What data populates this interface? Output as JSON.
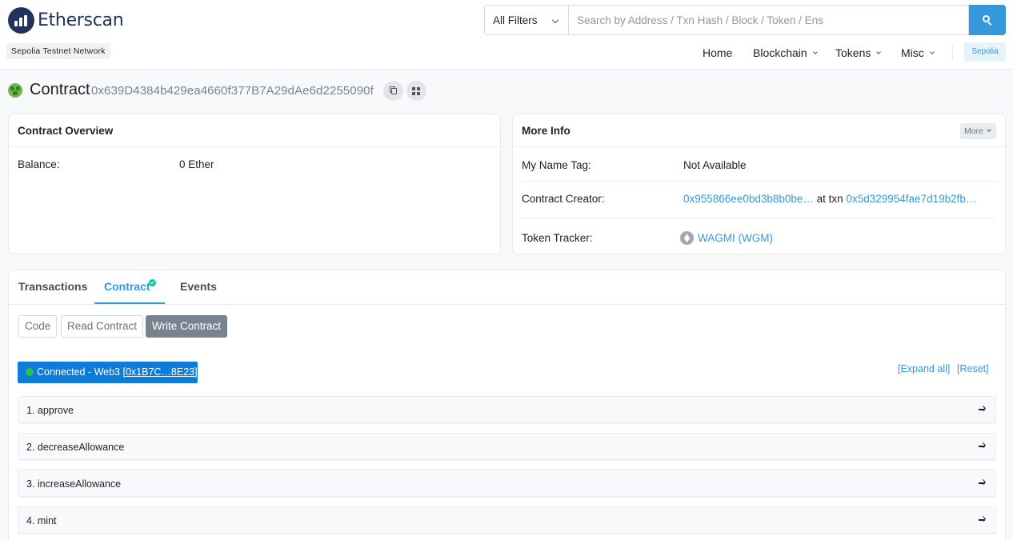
{
  "brand": {
    "name": "Etherscan",
    "network": "Sepolia Testnet Network"
  },
  "search": {
    "filter_label": "All Filters",
    "placeholder": "Search by Address / Txn Hash / Block / Token / Ens"
  },
  "nav": {
    "items": [
      {
        "label": "Home"
      },
      {
        "label": "Blockchain"
      },
      {
        "label": "Tokens"
      },
      {
        "label": "Misc"
      }
    ],
    "network_badge": "Sepolia"
  },
  "page": {
    "title": "Contract",
    "address": "0x639D4384b429ea4660f377B7A29dAe6d2255090f"
  },
  "overview": {
    "title": "Contract Overview",
    "balance_label": "Balance:",
    "balance_value": "0 Ether"
  },
  "more_info": {
    "title": "More Info",
    "more_button": "More",
    "name_tag_label": "My Name Tag:",
    "name_tag_value": "Not Available",
    "creator_label": "Contract Creator:",
    "creator_address": "0x955866ee0bd3b8b0be…",
    "creator_at_txn": "at txn",
    "creator_txn": "0x5d329954fae7d19b2fb…",
    "token_tracker_label": "Token Tracker:",
    "token_tracker_value": "WAGMI (WGM)"
  },
  "tabs": [
    {
      "label": "Transactions"
    },
    {
      "label": "Contract"
    },
    {
      "label": "Events"
    }
  ],
  "sub_tabs": [
    {
      "label": "Code"
    },
    {
      "label": "Read Contract"
    },
    {
      "label": "Write Contract"
    }
  ],
  "web3": {
    "status_text": "Connected - Web3",
    "address": "[0x1B7C…8E23]",
    "status_color": "#26c34a"
  },
  "tools": {
    "expand_all": "[Expand all]",
    "reset": "[Reset]"
  },
  "functions": [
    {
      "label": "1. approve"
    },
    {
      "label": "2. decreaseAllowance"
    },
    {
      "label": "3. increaseAllowance"
    },
    {
      "label": "4. mint"
    }
  ],
  "colors": {
    "accent": "#3498db",
    "brand": "#21325b",
    "verified": "#00c9a7"
  }
}
